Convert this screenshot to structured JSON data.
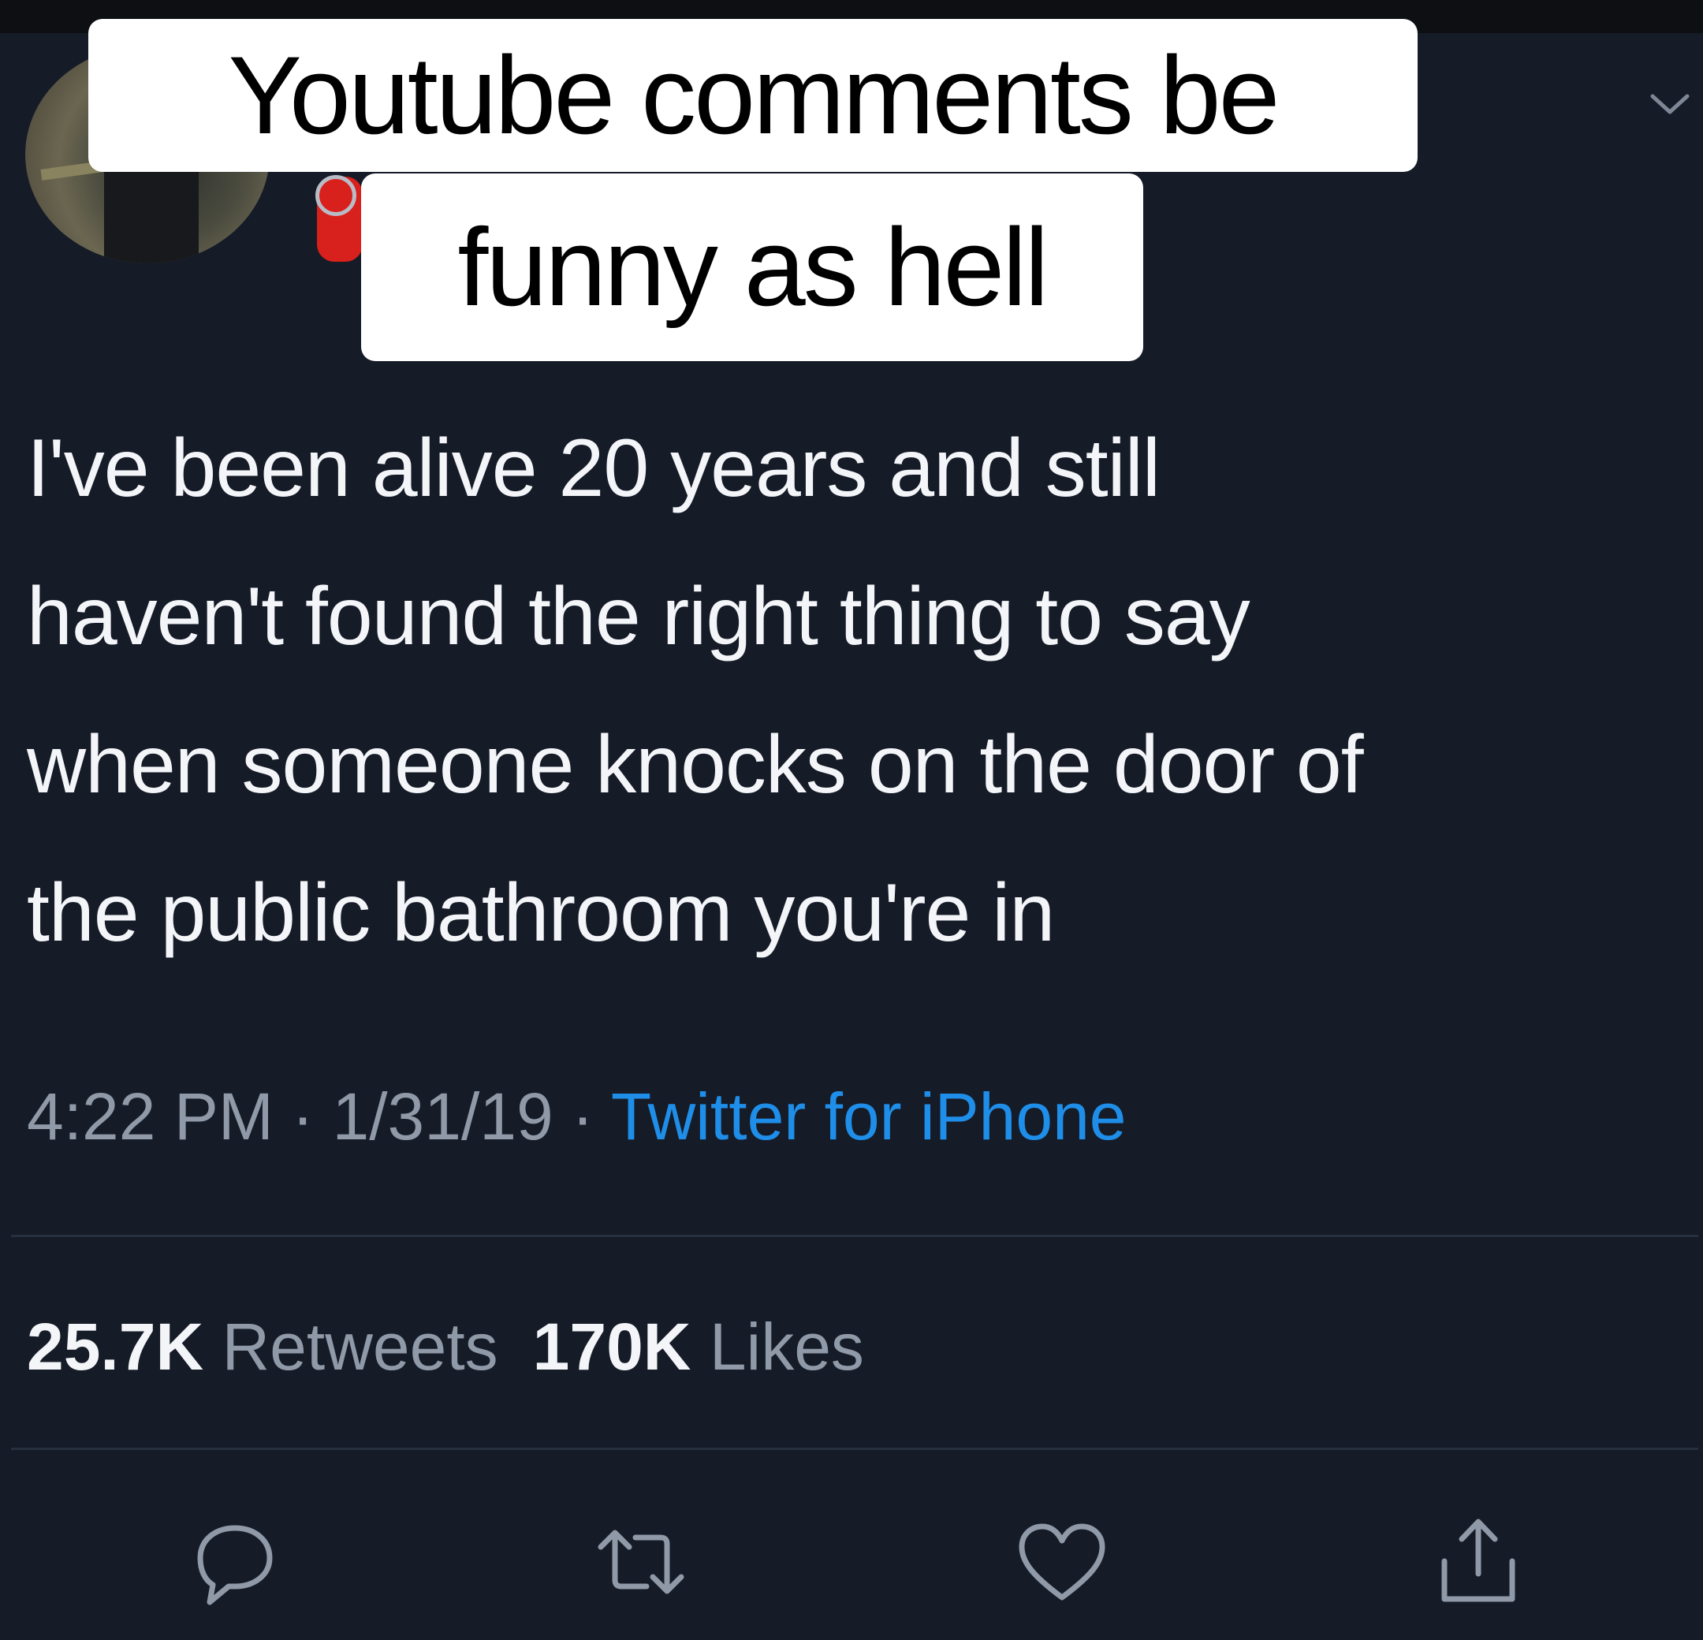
{
  "caption": {
    "line1": "Youtube comments be",
    "line2": "funny as hell"
  },
  "tweet": {
    "lines": [
      "I've been alive 20 years and still",
      "haven't found the right thing to say",
      "when someone knocks on the door of",
      "the public bathroom you're in"
    ],
    "time": "4:22 PM",
    "sep1": " · ",
    "date": "1/31/19",
    "sep2": " · ",
    "source": "Twitter for iPhone"
  },
  "stats": {
    "retweets_count": "25.7K",
    "retweets_label": "Retweets",
    "likes_count": "170K",
    "likes_label": "Likes"
  },
  "icons": {
    "header": [
      "avatar",
      "chevron-down-icon"
    ],
    "actions": [
      "reply-icon",
      "retweet-icon",
      "like-icon",
      "share-icon"
    ]
  },
  "colors": {
    "background": "#151b27",
    "text": "#f3f5f8",
    "muted": "#8f99a7",
    "link": "#1f8ee8"
  }
}
